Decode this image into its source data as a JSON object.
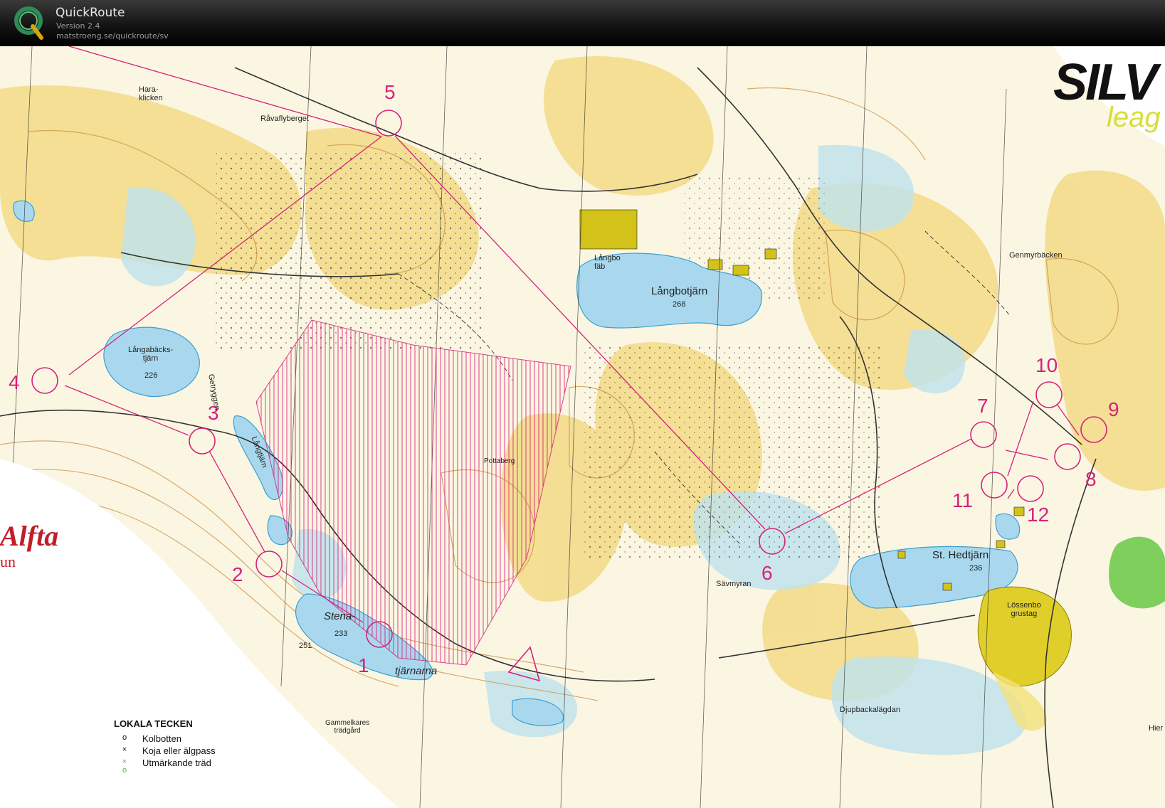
{
  "app": {
    "title": "QuickRoute",
    "version": "Version 2.4",
    "url": "matstroeng.se/quickroute/sv",
    "logo_letter": "Q",
    "logo_color": "#2e8b57"
  },
  "map": {
    "colors": {
      "paper": "#fbf6e2",
      "open_land": "#f2d77a",
      "water": "#a9d8ee",
      "marsh": "#6ec3e3",
      "contour": "#c98a3b",
      "course": "#d4237a",
      "building": "#d2c21a",
      "green": "#7fcf5c"
    },
    "brand": {
      "silva": "SILV",
      "league": "leag",
      "alfta": "Alfta",
      "alfta_sub": "un"
    },
    "controls": [
      "1",
      "2",
      "3",
      "4",
      "5",
      "6",
      "7",
      "8",
      "9",
      "10",
      "11",
      "12"
    ],
    "place_names": {
      "haraklicken": "Hara-\nklicken",
      "ravaflyberget": "Råvaflyberget",
      "langbo_fab": "Långbo\nfäb",
      "langbotjarn": "Långbotjärn",
      "langbotjarn_h": "268",
      "genmyrbacken": "Genmyrbäcken",
      "langabackstjarn": "Långabäcks-\ntjärn",
      "langabackstjarn_h": "226",
      "getryggen": "Getryggen",
      "langtjarn": "Långtjärn",
      "pottaberg": "Pottaberg",
      "sta_hedtjarn": "St. Hedtjärn",
      "sta_hedtjarn_h": "236",
      "savmyran": "Sävmyran",
      "lossenbo": "Lössenbo\ngrustag",
      "stena": "Stena-",
      "stena_h": "233",
      "tjarnarna": "tjärnarna",
      "h251": "251",
      "gammelkares": "Gammelkares\nträdgård",
      "djupbackalagdan": "Djupbackalägdan",
      "hier": "Hier"
    },
    "legend": {
      "title": "LOKALA TECKEN",
      "items": [
        {
          "symbol": "o",
          "label": "Kolbotten"
        },
        {
          "symbol": "×",
          "label": "Koja eller älgpass"
        },
        {
          "symbol": "× o",
          "label": "Utmärkande träd"
        }
      ]
    }
  }
}
